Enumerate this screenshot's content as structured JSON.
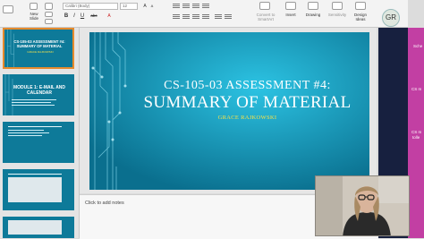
{
  "ribbon": {
    "new_slide_label": "New\nSlide",
    "font_name": "Calibri (Body)",
    "font_size": "12",
    "convert_to_smartart": "Convert to\nSmartArt",
    "insert": "Insert",
    "drawing": "Drawing",
    "sensitivity": "Sensitivity",
    "design_ideas": "Design\nIdeas",
    "bold": "B",
    "italic": "I",
    "underline": "U",
    "strike": "abc"
  },
  "account": {
    "initials": "GR"
  },
  "thumbnails": [
    {
      "number": "1",
      "title": "CS-105-03 ASSESSMENT #4:\nSUMMARY OF MATERIAL",
      "sub": "GRACE RAJKOWSKI"
    },
    {
      "number": "2",
      "title": "MODULE 1: E-MAIL AND CALENDAR",
      "sub": ""
    },
    {
      "number": "3",
      "title": "",
      "sub": ""
    },
    {
      "number": "4",
      "title": "",
      "sub": ""
    },
    {
      "number": "5",
      "title": "",
      "sub": ""
    }
  ],
  "slide": {
    "title": "CS-105-03 ASSESSMENT #4:",
    "subtitle": "SUMMARY OF MATERIAL",
    "author": "GRACE RAJKOWSKI"
  },
  "notes": {
    "placeholder": "Click to add notes"
  },
  "right_window": {
    "items": [
      "Sche",
      "CS m",
      "CS m",
      "tolle"
    ]
  },
  "colors": {
    "slide_bg": "#1197b8",
    "author_yellow": "#f6e24a",
    "selection": "#e58a2c"
  }
}
